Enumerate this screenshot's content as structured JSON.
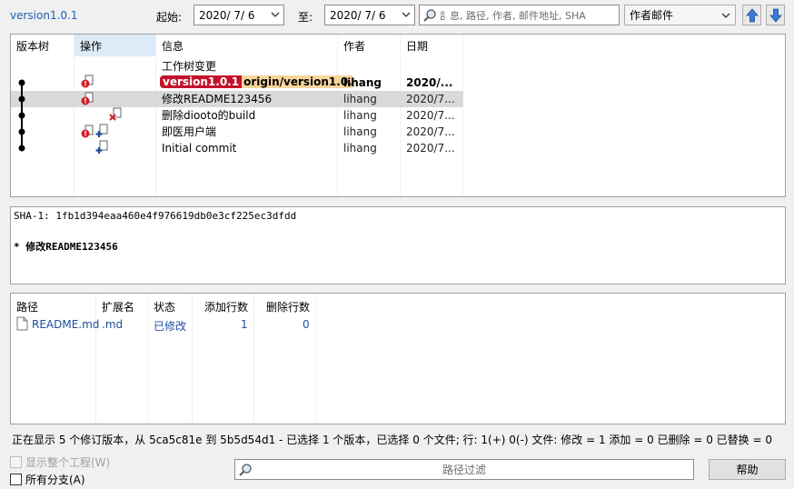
{
  "toolbar": {
    "branch": "version1.0.1",
    "from_label": "起始:",
    "from_date": "2020/  7/  6",
    "to_label": "至:",
    "to_date": "2020/  7/  6",
    "search_placeholder": "訁息, 路径, 作者, 邮件地址, SHA",
    "filter_mode": "作者邮件"
  },
  "log": {
    "columns": [
      "版本树",
      "操作",
      "信息",
      "作者",
      "日期"
    ],
    "rows": [
      {
        "message": "工作树变更",
        "author": "",
        "date": ""
      },
      {
        "tag_local": "version1.0.1",
        "tag_remote": "origin/version1.0.",
        "message": "",
        "author": "lihang",
        "date": "2020/..."
      },
      {
        "message": "修改README123456",
        "author": "lihang",
        "date": "2020/7..."
      },
      {
        "message": "删除diooto的build",
        "author": "lihang",
        "date": "2020/7..."
      },
      {
        "message": "即医用户端",
        "author": "lihang",
        "date": "2020/7..."
      },
      {
        "message": "Initial commit",
        "author": "lihang",
        "date": "2020/7..."
      }
    ]
  },
  "detail": {
    "sha": "SHA-1: 1fb1d394eaa460e4f976619db0e3cf225ec3dfdd",
    "message": "* 修改README123456"
  },
  "files": {
    "columns": [
      "路径",
      "扩展名",
      "状态",
      "添加行数",
      "删除行数"
    ],
    "rows": [
      {
        "path": "README.md",
        "ext": ".md",
        "status": "已修改",
        "added": "1",
        "deleted": "0"
      }
    ]
  },
  "statusbar": {
    "text": "正在显示 5 个修订版本，从 5ca5c81e 到 5b5d54d1 - 已选择 1 个版本，已选择 0 个文件; 行: 1(+) 0(-) 文件: 修改 = 1 添加 = 0 已删除 = 0 已替换 = 0"
  },
  "bottom": {
    "show_whole_project": "显示整个工程(W)",
    "all_branches": "所有分支(A)",
    "path_filter_placeholder": "路径过滤",
    "help": "帮助"
  },
  "colors": {
    "accent": "#1e5fb4",
    "selection": "#d9d9d9",
    "tag_local": "#c4122b",
    "tag_remote": "#f7d59c"
  }
}
